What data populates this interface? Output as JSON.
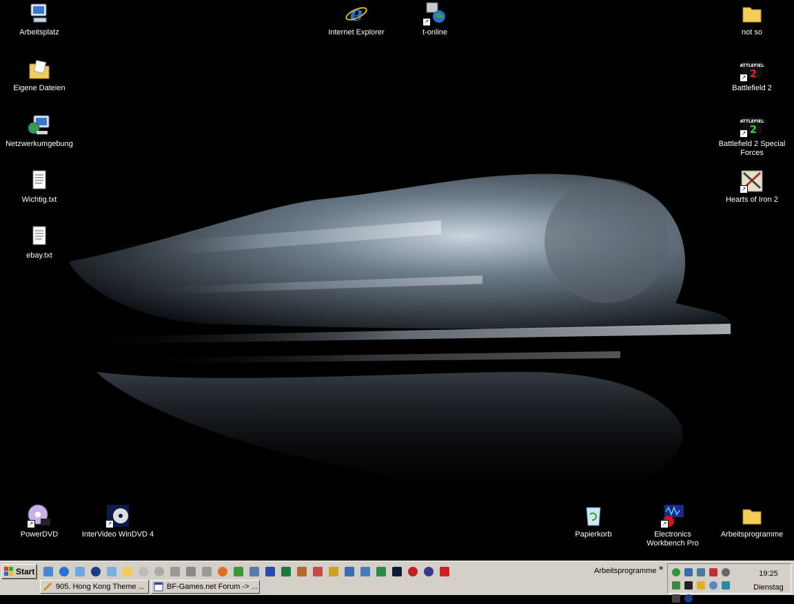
{
  "desktop": {
    "icons": {
      "arbeitsplatz": "Arbeitsplatz",
      "eigene_dateien": "Eigene Dateien",
      "netzwerkumgebung": "Netzwerkumgebung",
      "wichtig": "Wichtig.txt",
      "ebay": "ebay.txt",
      "internet_explorer": "Internet Explorer",
      "t_online": "t-online",
      "not_so": "not so",
      "battlefield2": "Battlefield 2",
      "battlefield2_sf": "Battlefield 2 Special Forces",
      "hearts_of_iron": "Hearts of Iron 2",
      "powerdvd": "PowerDVD",
      "windvd": "InterVideo WinDVD 4",
      "papierkorb": "Papierkorb",
      "ewb": "Electronics Workbench Pro",
      "arbeitsprogramme": "Arbeitsprogramme"
    }
  },
  "taskbar": {
    "start_label": "Start",
    "tasks": [
      {
        "label": "905. Hong Kong Theme ..."
      },
      {
        "label": "BF-Games.net Forum -> ..."
      }
    ],
    "toolbar_label": "Arbeitsprogramme",
    "toolbar_chevron": "»",
    "clock": "19:25",
    "day": "Dienstag"
  }
}
